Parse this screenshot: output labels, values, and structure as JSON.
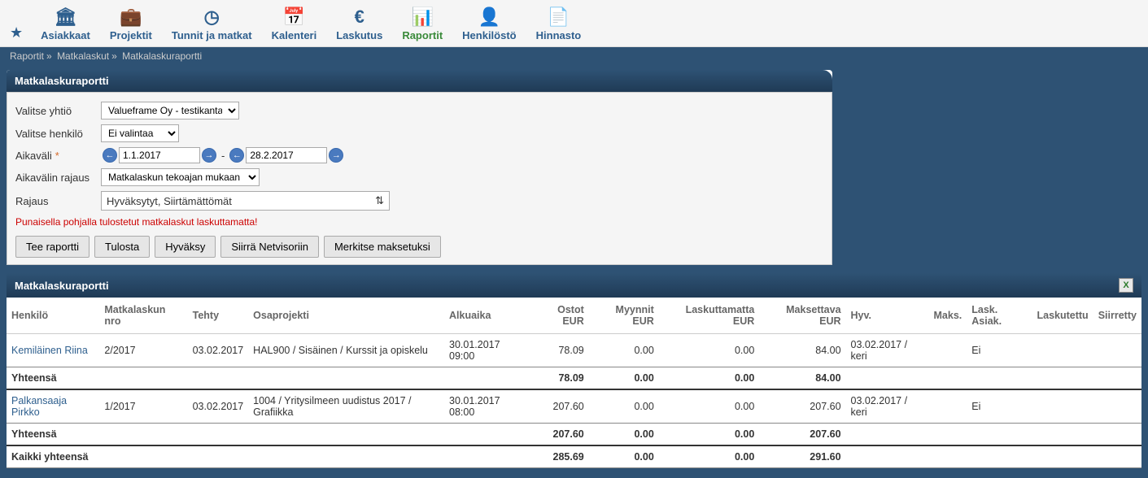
{
  "nav": {
    "star": "★",
    "items": [
      {
        "label": "Asiakkaat",
        "icon": "🏛"
      },
      {
        "label": "Projektit",
        "icon": "💼"
      },
      {
        "label": "Tunnit ja matkat",
        "icon": "◷"
      },
      {
        "label": "Kalenteri",
        "icon": "📅"
      },
      {
        "label": "Laskutus",
        "icon": "€"
      },
      {
        "label": "Raportit",
        "icon": "📊",
        "active": true
      },
      {
        "label": "Henkilöstö",
        "icon": "👤"
      },
      {
        "label": "Hinnasto",
        "icon": "📄"
      }
    ]
  },
  "breadcrumb": [
    "Raportit",
    "Matkalaskut",
    "Matkalaskuraportti"
  ],
  "panel": {
    "title": "Matkalaskuraportti",
    "company_label": "Valitse yhtiö",
    "company_value": "Valueframe Oy - testikanta!",
    "person_label": "Valitse henkilö",
    "person_value": "Ei valintaa",
    "period_label": "Aikaväli",
    "period_from": "1.1.2017",
    "period_sep": "-",
    "period_to": "28.2.2017",
    "limit_label": "Aikavälin rajaus",
    "limit_value": "Matkalaskun tekoajan mukaan",
    "filter_label": "Rajaus",
    "filter_value": "Hyväksytyt, Siirtämättömät",
    "notice": "Punaisella pohjalla tulostetut matkalaskut laskuttamatta!",
    "buttons": {
      "b1": "Tee raportti",
      "b2": "Tulosta",
      "b3": "Hyväksy",
      "b4": "Siirrä Netvisoriin",
      "b5": "Merkitse maksetuksi"
    }
  },
  "report": {
    "title": "Matkalaskuraportti",
    "headers": {
      "person": "Henkilö",
      "nro": "Matkalaskun nro",
      "made": "Tehty",
      "subproj": "Osaprojekti",
      "start": "Alkuaika",
      "buy": "Ostot EUR",
      "sell": "Myynnit EUR",
      "unbilled": "Laskuttamatta EUR",
      "payable": "Maksettava EUR",
      "appr": "Hyv.",
      "paid": "Maks.",
      "billcust": "Lask. Asiak.",
      "billed": "Laskutettu",
      "transf": "Siirretty"
    },
    "rows": [
      {
        "person": "Kemiläinen Riina",
        "nro": "2/2017",
        "made": "03.02.2017",
        "subproj": "HAL900 / Sisäinen / Kurssit ja opiskelu",
        "start": "30.01.2017 09:00",
        "buy": "78.09",
        "sell": "0.00",
        "unbilled": "0.00",
        "payable": "84.00",
        "appr": "03.02.2017 / keri",
        "paid": "",
        "billcust": "Ei",
        "billed": "",
        "transf": ""
      }
    ],
    "sub1": {
      "label": "Yhteensä",
      "buy": "78.09",
      "sell": "0.00",
      "unbilled": "0.00",
      "payable": "84.00"
    },
    "rows2": [
      {
        "person": "Palkansaaja Pirkko",
        "nro": "1/2017",
        "made": "03.02.2017",
        "subproj": "1004 / Yritysilmeen uudistus 2017 / Grafiikka",
        "start": "30.01.2017 08:00",
        "buy": "207.60",
        "sell": "0.00",
        "unbilled": "0.00",
        "payable": "207.60",
        "appr": "03.02.2017 / keri",
        "paid": "",
        "billcust": "Ei",
        "billed": "",
        "transf": ""
      }
    ],
    "sub2": {
      "label": "Yhteensä",
      "buy": "207.60",
      "sell": "0.00",
      "unbilled": "0.00",
      "payable": "207.60"
    },
    "grand": {
      "label": "Kaikki yhteensä",
      "buy": "285.69",
      "sell": "0.00",
      "unbilled": "0.00",
      "payable": "291.60"
    }
  }
}
